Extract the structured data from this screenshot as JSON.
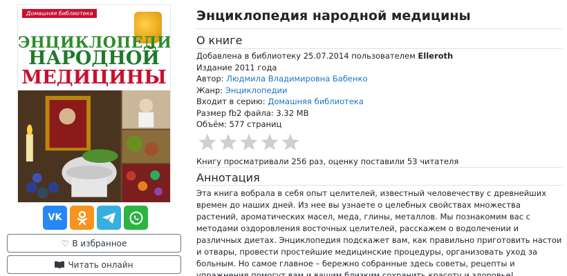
{
  "book": {
    "title": "Энциклопедия народной медицины",
    "cover": {
      "series_tag": "Домашняя библиотека",
      "line1": "ЭНЦИКЛОПЕДИЯ",
      "line2": "НАРОДНОЙ",
      "line3": "МЕДИЦИНЫ"
    }
  },
  "about": {
    "heading": "О книге",
    "added_prefix": "Добавлена в библиотеку 25.07.2014 пользователем",
    "added_user": "Elleroth",
    "edition": "Издание 2011 года",
    "author_label": "Автор:",
    "author": "Людмила Владимировна Бабенко",
    "genre_label": "Жанр:",
    "genre": "Энциклопедии",
    "series_label": "Входит в серию:",
    "series": "Домашняя библиотека",
    "size_label": "Размер fb2 файла:",
    "size": "3.32 MB",
    "volume_label": "Объём:",
    "volume": "577 страниц",
    "rating": 0,
    "rating_max": 5,
    "views_text": "Книгу просматривали 256 раз, оценку поставили 53 читателя"
  },
  "annotation": {
    "heading": "Аннотация",
    "text": "Эта книга вобрала в себя опыт целителей, известный человечеству с древнейших времен до наших дней. Из нее вы узнаете о целебных свойствах множества растений, ароматических масел, меда, глины, металлов. Мы познакомим вас с методами оздоровления восточных целителей, расскажем о водолечении и различных диетах. Энциклопедия подскажет вам, как правильно приготовить настои и отвары, провести простейшие медицинские процедуры, организовать уход за больным. Но самое главное – бережно собранные здесь советы, рецепты и упражнения помогут вам и вашим близким сохранить красоту и здоровье!"
  },
  "share": {
    "vk": "vk-icon",
    "ok": "odnoklassniki-icon",
    "telegram": "telegram-icon",
    "whatsapp": "whatsapp-icon"
  },
  "buttons": {
    "favorite": "В избранное",
    "read_online": "Читать онлайн"
  },
  "colors": {
    "link": "#1a73c8",
    "vk": "#2787f5",
    "ok": "#f7931e",
    "telegram": "#37aee2",
    "whatsapp": "#2ab540",
    "star_empty": "#cfcfcf"
  }
}
